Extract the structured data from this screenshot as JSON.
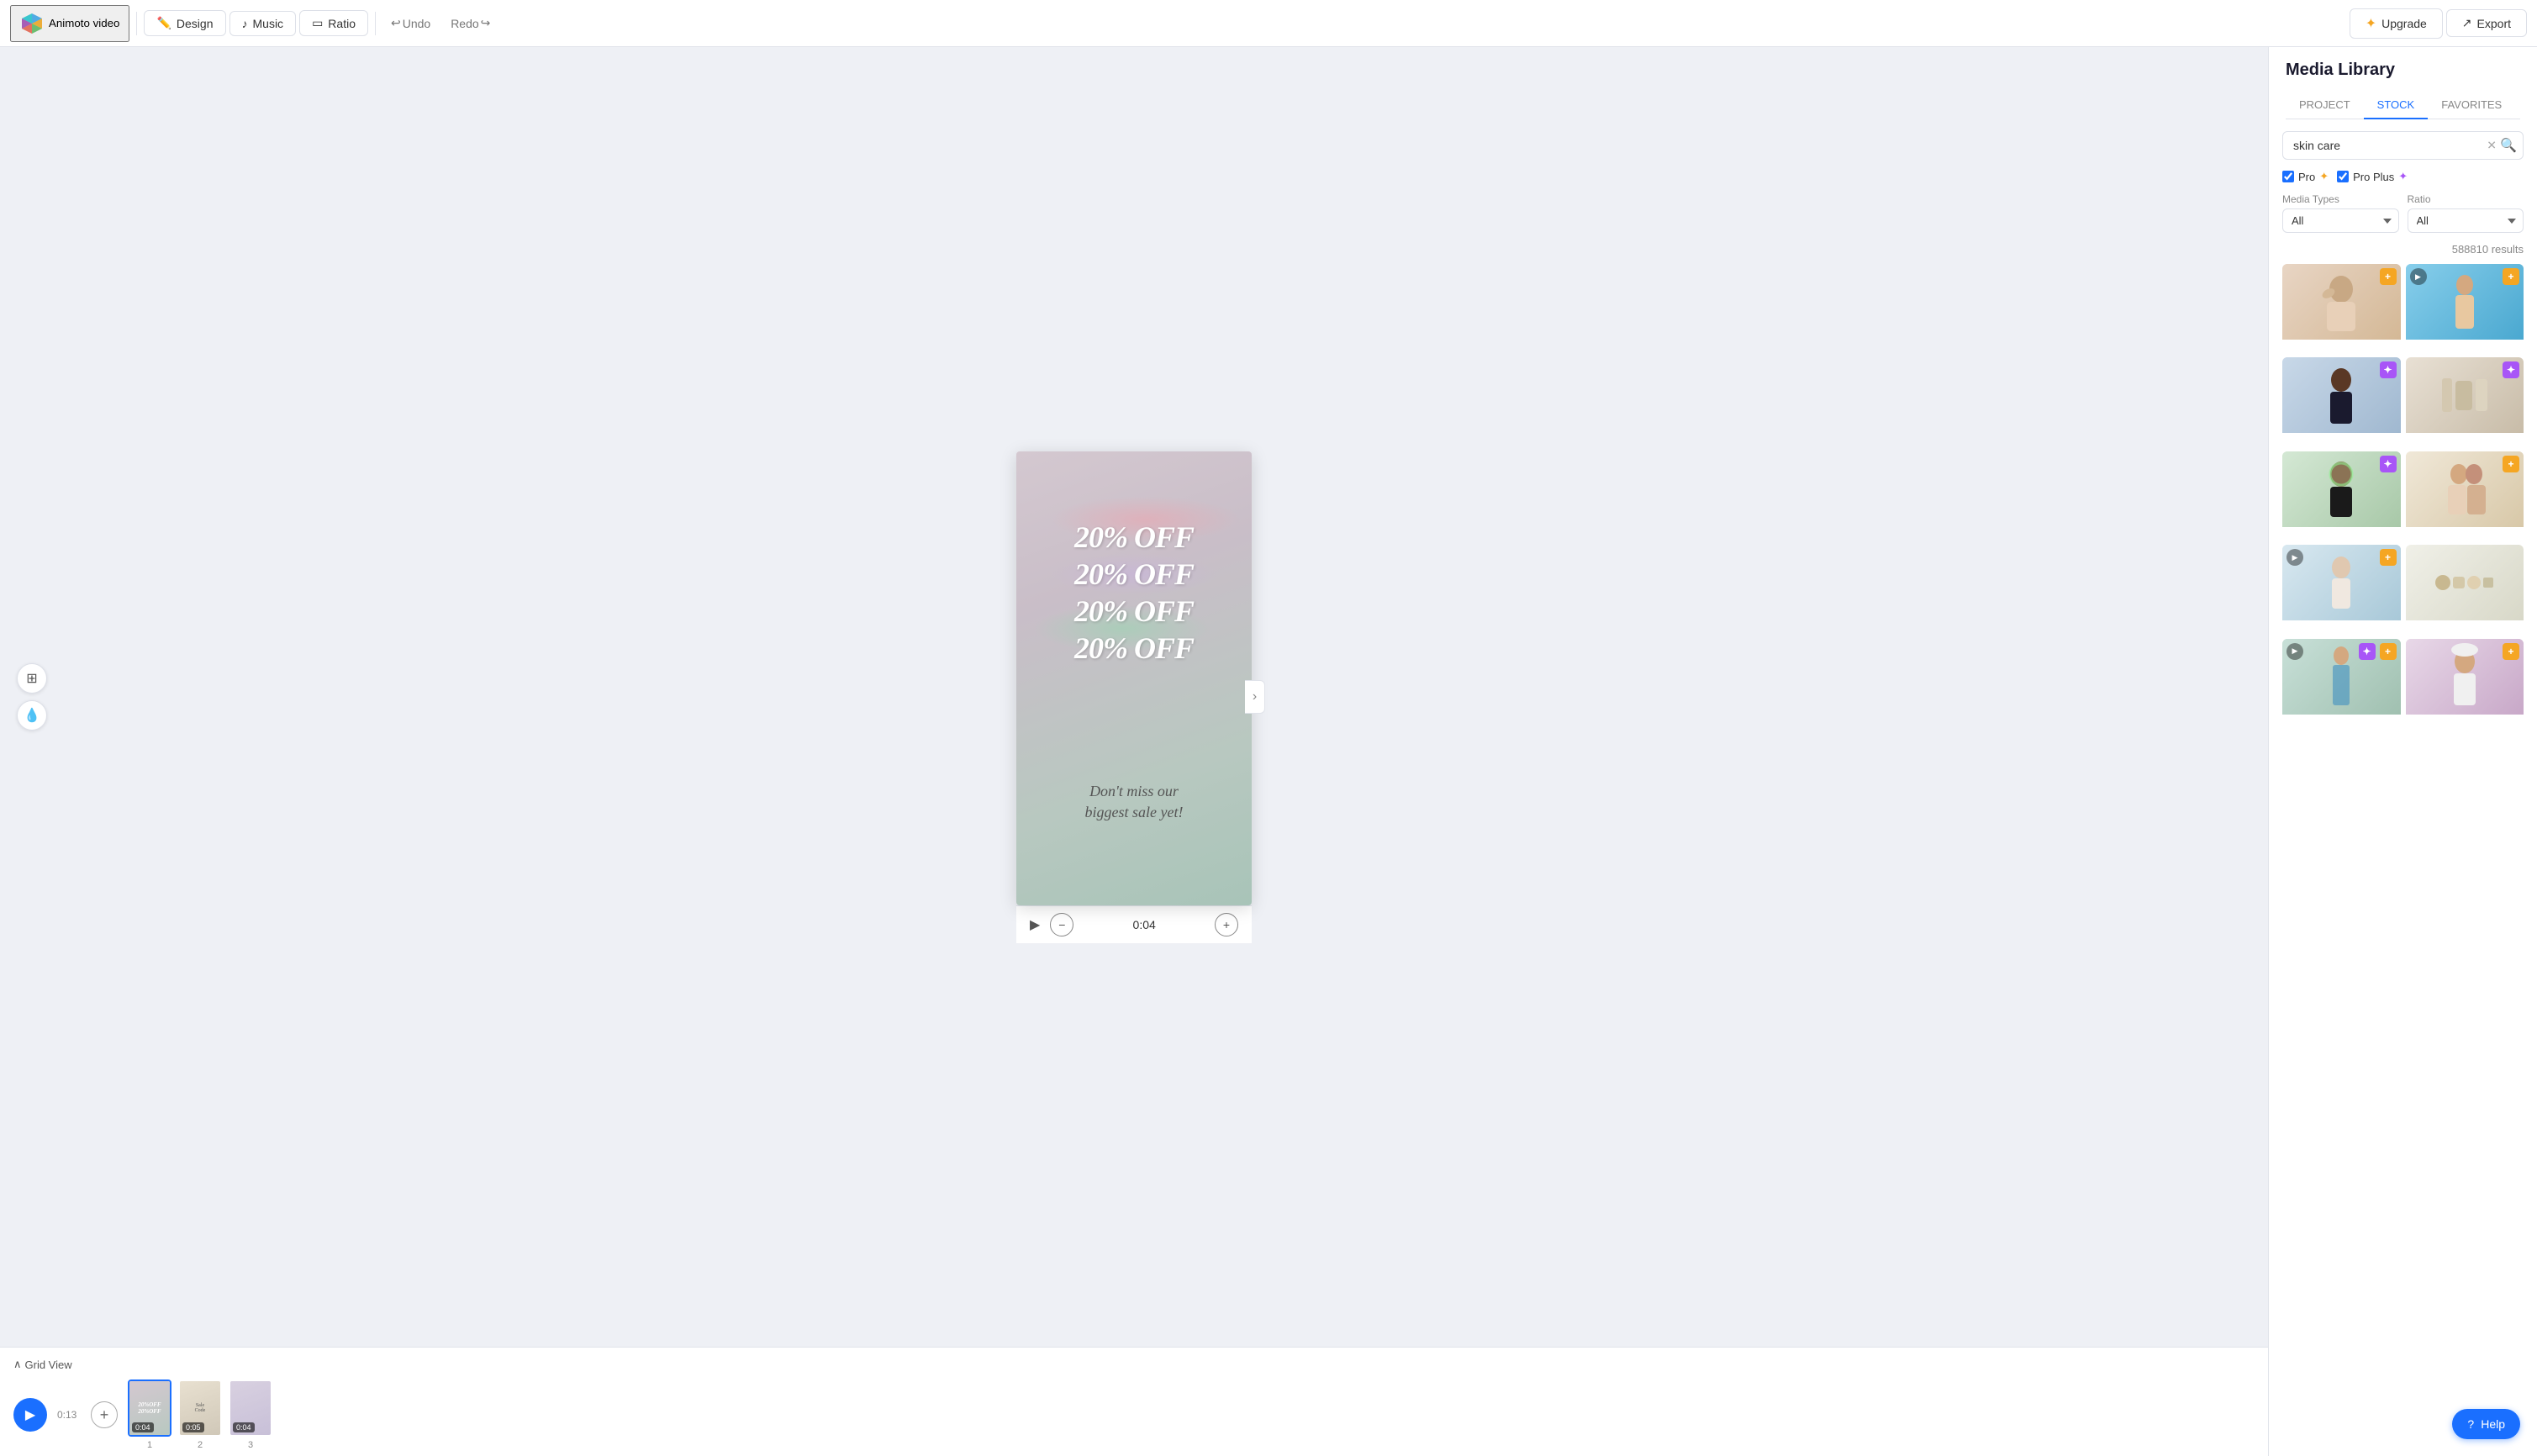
{
  "app": {
    "title": "Animoto video"
  },
  "topnav": {
    "logo_label": "Animoto video",
    "design_label": "Design",
    "music_label": "Music",
    "ratio_label": "Ratio",
    "undo_label": "Undo",
    "redo_label": "Redo",
    "upgrade_label": "Upgrade",
    "export_label": "Export"
  },
  "canvas": {
    "sale_lines": [
      "20% OFF",
      "20% OFF",
      "20% OFF",
      "20% OFF"
    ],
    "tagline_line1": "Don't miss our",
    "tagline_line2": "biggest sale yet!",
    "time_display": "0:04"
  },
  "timeline": {
    "collapse_label": "Grid View",
    "total_time": "0:13",
    "slides": [
      {
        "number": "1",
        "duration": "0:04",
        "active": true
      },
      {
        "number": "2",
        "duration": "0:05",
        "active": false
      },
      {
        "number": "3",
        "duration": "0:04",
        "active": false
      }
    ]
  },
  "media_library": {
    "title": "Media Library",
    "tabs": [
      "PROJECT",
      "STOCK",
      "FAVORITES"
    ],
    "active_tab": "STOCK",
    "search_placeholder": "skin care",
    "search_value": "skin care",
    "filters": {
      "pro_label": "Pro",
      "pro_plus_label": "Pro Plus"
    },
    "media_types_label": "Media Types",
    "media_types_value": "All",
    "ratio_label": "Ratio",
    "ratio_value": "All",
    "results_count": "588810 results",
    "images": [
      {
        "id": 1,
        "badge": "gold",
        "has_play": false,
        "style": "img1"
      },
      {
        "id": 2,
        "badge": "gold",
        "has_play": true,
        "style": "img2"
      },
      {
        "id": 3,
        "badge": "purple",
        "has_play": false,
        "style": "img3"
      },
      {
        "id": 4,
        "badge": "purple",
        "has_play": false,
        "style": "img4"
      },
      {
        "id": 5,
        "badge": "purple",
        "has_play": false,
        "style": "img5"
      },
      {
        "id": 6,
        "badge": "gold",
        "has_play": false,
        "style": "img6"
      },
      {
        "id": 7,
        "badge": "gold",
        "has_play": true,
        "style": "img7"
      },
      {
        "id": 8,
        "badge": "none",
        "has_play": false,
        "style": "img8"
      },
      {
        "id": 9,
        "badge": "purple",
        "has_play": false,
        "style": "img9"
      },
      {
        "id": 10,
        "badge": "gold",
        "has_play": false,
        "style": "img10"
      }
    ]
  },
  "help": {
    "label": "Help"
  }
}
